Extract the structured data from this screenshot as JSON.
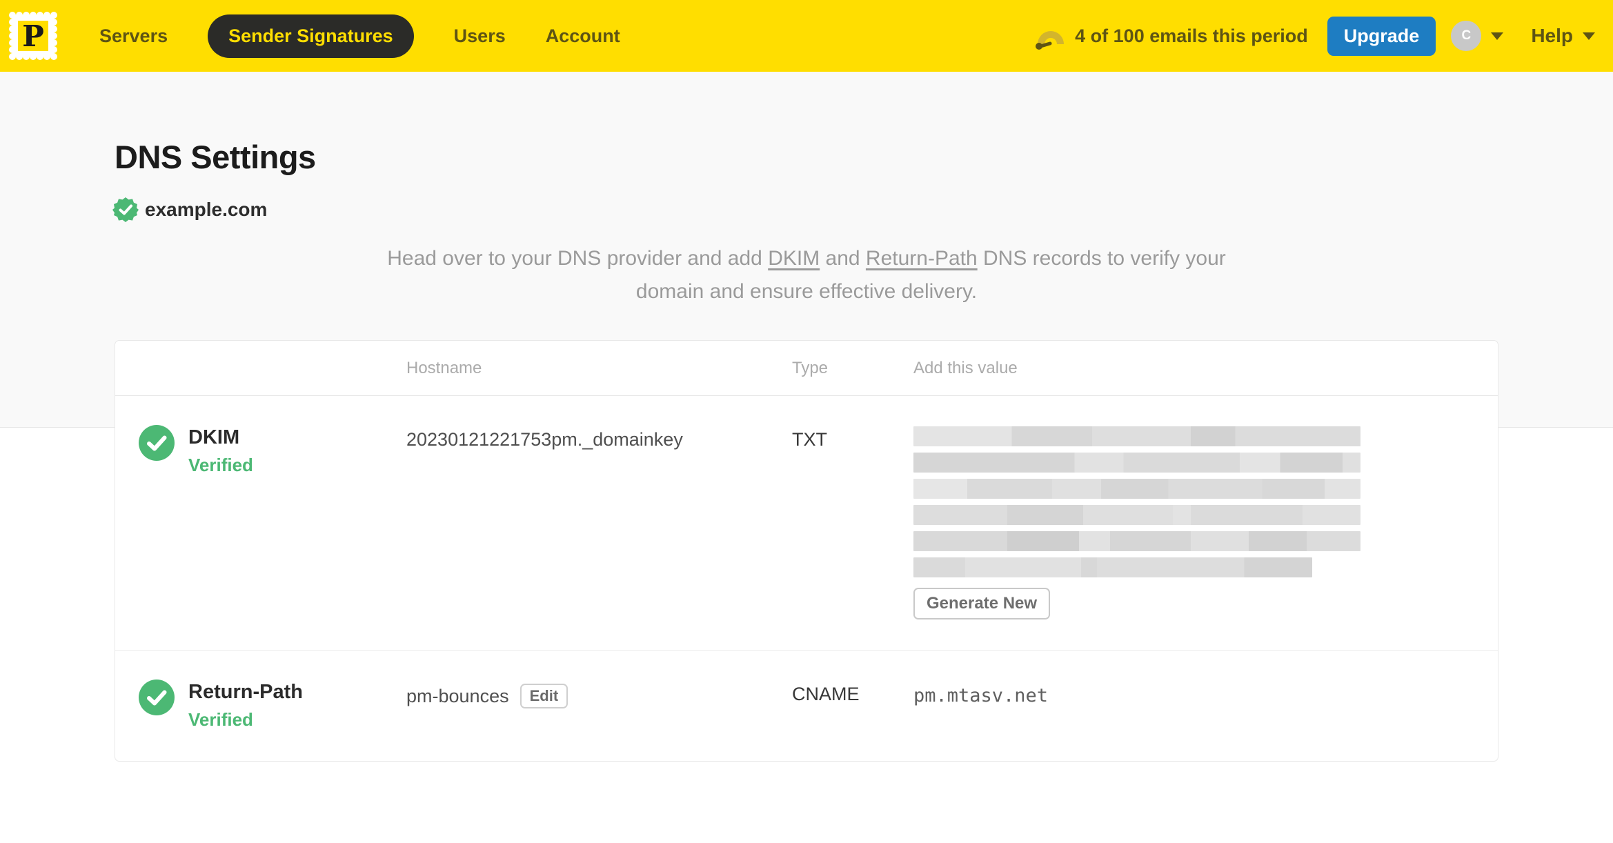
{
  "nav": {
    "logo_letter": "P",
    "items": [
      {
        "label": "Servers",
        "active": false
      },
      {
        "label": "Sender Signatures",
        "active": true
      },
      {
        "label": "Users",
        "active": false
      },
      {
        "label": "Account",
        "active": false
      }
    ],
    "usage_text": "4 of 100 emails this period",
    "upgrade_label": "Upgrade",
    "avatar_initial": "C",
    "help_label": "Help"
  },
  "page": {
    "title": "DNS Settings",
    "domain": "example.com",
    "description": {
      "pre": "Head over to your DNS provider and add ",
      "link1": "DKIM",
      "mid": " and ",
      "link2": "Return-Path",
      "post": " DNS records to verify your domain and ensure effective delivery."
    }
  },
  "table": {
    "headers": {
      "hostname": "Hostname",
      "type": "Type",
      "value": "Add this value"
    },
    "rows": [
      {
        "name": "DKIM",
        "status": "Verified",
        "hostname": "20230121221753pm._domainkey",
        "type": "TXT",
        "value_redacted": true,
        "action_label": "Generate New"
      },
      {
        "name": "Return-Path",
        "status": "Verified",
        "hostname": "pm-bounces",
        "edit_label": "Edit",
        "type": "CNAME",
        "value": "pm.mtasv.net"
      }
    ]
  },
  "colors": {
    "brand_yellow": "#ffde00",
    "nav_text": "#5e5414",
    "active_pill": "#2b2b28",
    "upgrade_blue": "#1e7dc2",
    "verified_green": "#4cb874",
    "muted_gray": "#9a9a9a"
  }
}
